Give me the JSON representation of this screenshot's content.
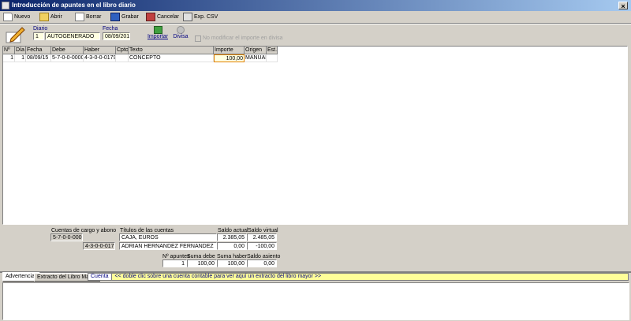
{
  "window": {
    "title": "Introducción de apuntes en el libro diario",
    "close": "×"
  },
  "toolbar": {
    "nuevo": "Nuevo",
    "abrir": "Abrir",
    "borrar": "Borrar",
    "grabar": "Grabar",
    "cancelar": "Cancelar",
    "exp_csv": "Exp. CSV"
  },
  "header": {
    "diario_label": "Diario",
    "diario_num": "1",
    "diario_name": "AUTOGENERADO",
    "fecha_label": "Fecha",
    "fecha_value": "08/09/2015",
    "importar": "Importar",
    "divisa": "Divisa",
    "no_modificar": "No modificar el importe en divisa"
  },
  "grid": {
    "columns": [
      "Nº",
      "Día",
      "Fecha",
      "Debe",
      "Haber",
      "Cpto.",
      "Texto",
      "Importe",
      "Origen",
      "Est."
    ],
    "rows": [
      {
        "num": "1",
        "dia": "1",
        "fecha": "08/09/15",
        "debe": "5-7-0-0-0000",
        "haber": "4-3-0-0-0179",
        "cpto": "",
        "texto": "CONCEPTO",
        "importe": "100,00",
        "origen": "MANUAL",
        "est": ""
      }
    ]
  },
  "summary": {
    "cuentas_label": "Cuentas de cargo y abono",
    "titulos_label": "Títulos de las cuentas",
    "saldo_actual_label": "Saldo actual",
    "saldo_virtual_label": "Saldo virtual",
    "cuenta1": "5-7-0-0-0000",
    "titulo1": "CAJA, EUROS",
    "saldo_actual1": "2.385,05",
    "saldo_virtual1": "2.485,05",
    "cuenta2": "4-3-0-0-0179",
    "titulo2": "ADRIAN HERNANDEZ FERNANDEZ",
    "saldo_actual2": "0,00",
    "saldo_virtual2": "-100,00",
    "napuntes_label": "Nº apuntes",
    "suma_debe_label": "Suma debe",
    "suma_haber_label": "Suma haber",
    "saldo_asiento_label": "Saldo asiento",
    "napuntes": "1",
    "suma_debe": "100,00",
    "suma_haber": "100,00",
    "saldo_asiento": "0,00"
  },
  "tabs": {
    "advertencias": "Advertencias",
    "extracto": "Extracto del Libro Mayor",
    "cuenta": "Cuenta",
    "hint": "<< doble clic sobre una cuenta contable para ver aquí un extracto del libro mayor >>"
  },
  "colors": {
    "title_start": "#0a246a",
    "title_end": "#a6caf0",
    "field_yellow": "#ffffe1",
    "hint_bar": "#ffff99",
    "face": "#d4d0c8"
  }
}
